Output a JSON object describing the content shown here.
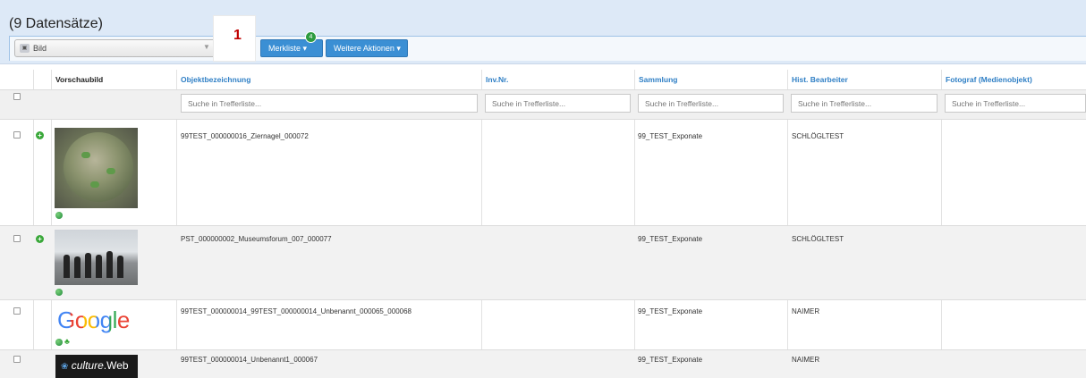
{
  "header": {
    "title": "(9 Datensätze)",
    "view_select": "Bild",
    "view_select_icon": "image-icon",
    "annotation_number": "1",
    "merkliste_label": "Merkliste",
    "merkliste_badge": "4",
    "weitere_label": "Weitere Aktionen"
  },
  "columns": [
    "Vorschaubild",
    "Objektbezeichnung",
    "Inv.Nr.",
    "Sammlung",
    "Hist. Bearbeiter",
    "Fotograf (Medienobjekt)"
  ],
  "search_placeholder": "Suche in Trefferliste...",
  "rows": [
    {
      "thumb": "coin-image",
      "objekt": "99TEST_000000016_Ziernagel_000072",
      "inv": "",
      "sammlung": "99_TEST_Exponate",
      "bearbeiter": "SCHLÖGLTEST",
      "fotograf": ""
    },
    {
      "thumb": "group-photo-image",
      "objekt": "PST_000000002_Museumsforum_007_000077",
      "inv": "",
      "sammlung": "99_TEST_Exponate",
      "bearbeiter": "SCHLÖGLTEST",
      "fotograf": ""
    },
    {
      "thumb": "google-logo-image",
      "thumb_text": "Google",
      "objekt": "99TEST_000000014_99TEST_000000014_Unbenannt_000065_000068",
      "inv": "",
      "sammlung": "99_TEST_Exponate",
      "bearbeiter": "NAIMER",
      "fotograf": ""
    },
    {
      "thumb": "cultureweb-logo-image",
      "thumb_text_italic": "culture",
      "thumb_text_rest": ".Web",
      "objekt": "99TEST_000000014_Unbenannt1_000067",
      "inv": "",
      "sammlung": "99_TEST_Exponate",
      "bearbeiter": "NAIMER",
      "fotograf": ""
    }
  ],
  "colors": {
    "accent": "#3b8fd4",
    "header_bg": "#dde9f7",
    "link": "#2f7fc5",
    "annotation": "#c00000",
    "add": "#3aa83a"
  }
}
